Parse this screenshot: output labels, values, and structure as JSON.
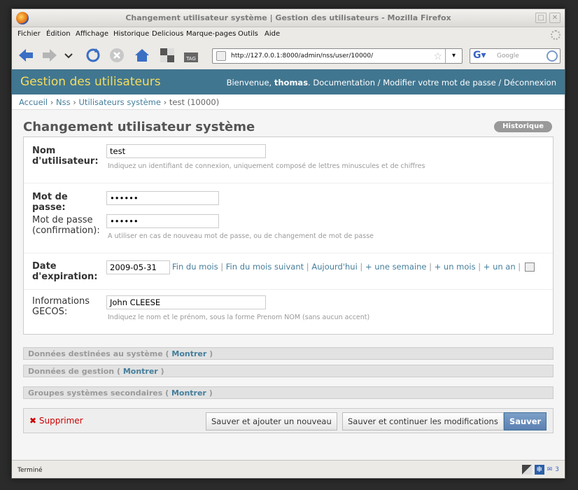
{
  "window": {
    "title": "Changement utilisateur système | Gestion des utilisateurs - Mozilla Firefox"
  },
  "menu": [
    "Fichier",
    "Édition",
    "Affichage",
    "Historique",
    "Delicious",
    "Marque-pages",
    "Outils",
    "Aide"
  ],
  "toolbar": {
    "url": "http://127.0.0.1:8000/admin/nss/user/10000/",
    "search_placeholder": "Google"
  },
  "header": {
    "brand": "Gestion des utilisateurs",
    "welcome": "Bienvenue,",
    "username": "thomas",
    "links_text": ". Documentation / Modifier votre mot de passe / Déconnexion"
  },
  "breadcrumb": {
    "home": "Accueil",
    "app": "Nss",
    "model": "Utilisateurs système",
    "current": "test (10000)"
  },
  "page": {
    "title": "Changement utilisateur système",
    "history_button": "Historique"
  },
  "form": {
    "username": {
      "label": "Nom d'utilisateur:",
      "value": "test",
      "help": "Indiquez un identifiant de connexion, uniquement composé de lettres minuscules et de chiffres"
    },
    "password": {
      "label": "Mot de passe:",
      "value": "••••••",
      "confirm_label": "Mot de passe (confirmation):",
      "confirm_value": "••••••",
      "help": "A utiliser en cas de nouveau mot de passe, ou de changement de mot de passe"
    },
    "expiration": {
      "label": "Date d'expiration:",
      "value": "2009-05-31",
      "shortcuts": [
        "Fin du mois",
        "Fin du mois suivant",
        "Aujourd'hui",
        "+ une semaine",
        "+ un mois",
        "+ un an"
      ]
    },
    "gecos": {
      "label": "Informations GECOS:",
      "value": "John CLEESE",
      "help": "Indiquez le nom et le prénom, sous la forme Prenom NOM (sans aucun accent)"
    }
  },
  "sections": [
    {
      "title": "Données destinées au système",
      "toggle": "Montrer"
    },
    {
      "title": "Données de gestion",
      "toggle": "Montrer"
    },
    {
      "title": "Groupes systèmes secondaires",
      "toggle": "Montrer"
    }
  ],
  "actions": {
    "delete": "Supprimer",
    "save_add": "Sauver et ajouter un nouveau",
    "save_continue": "Sauver et continuer les modifications",
    "save": "Sauver"
  },
  "statusbar": {
    "text": "Terminé",
    "mail_count": "3"
  }
}
